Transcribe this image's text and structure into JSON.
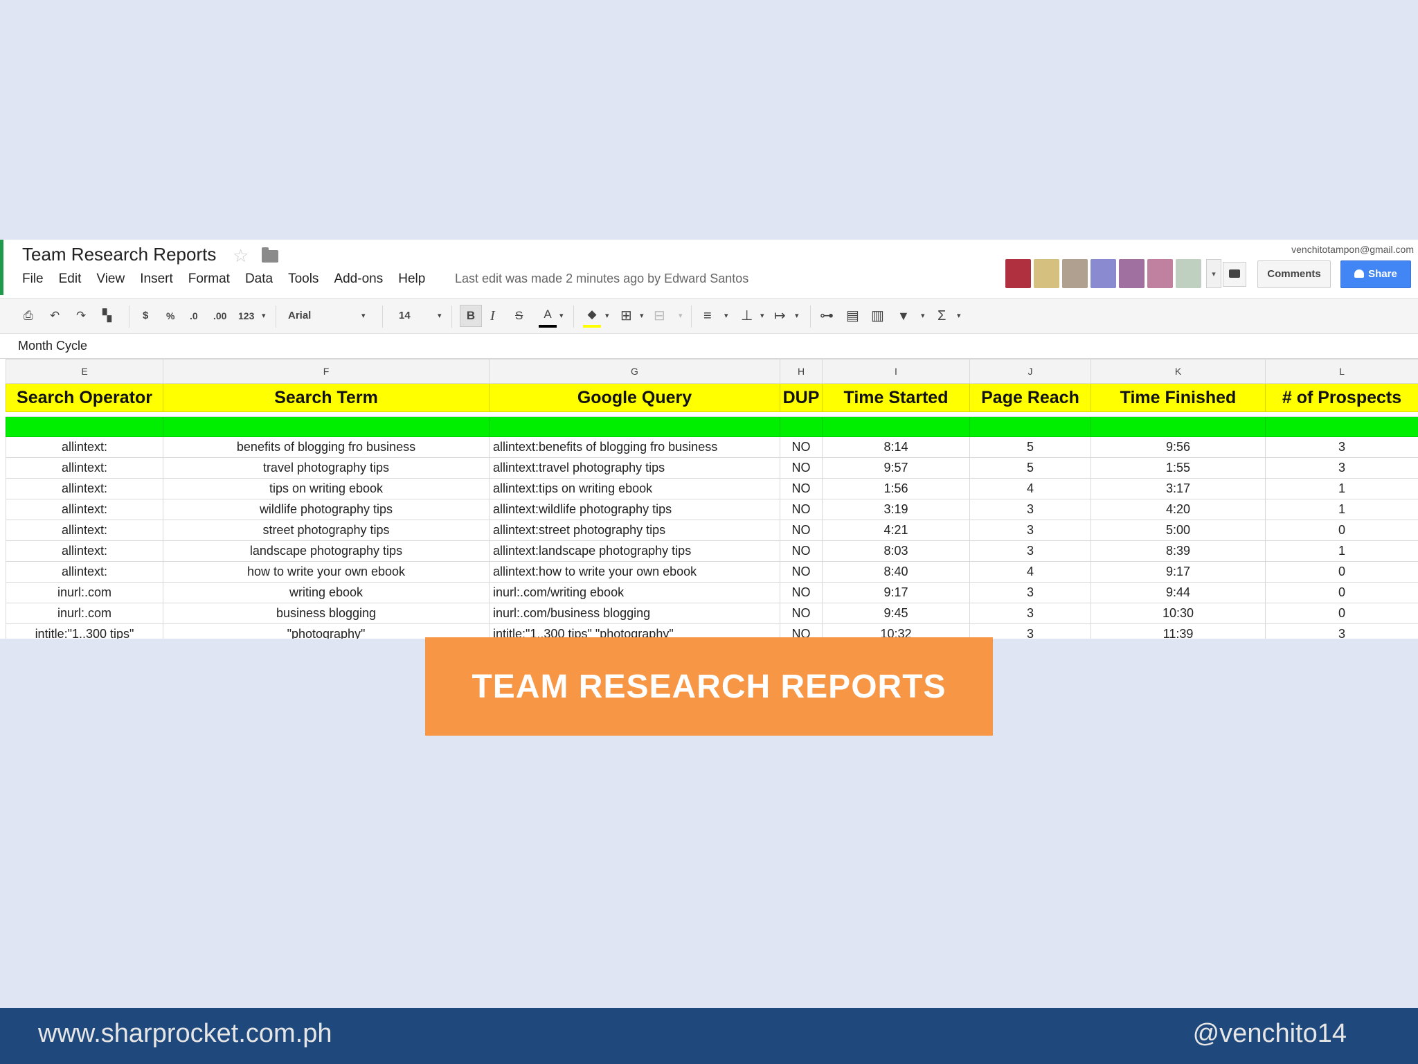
{
  "doc": {
    "title": "Team Research Reports",
    "account": "venchitotampon@gmail.com",
    "last_edit": "Last edit was made 2 minutes ago by Edward Santos",
    "menu": [
      "File",
      "Edit",
      "View",
      "Insert",
      "Format",
      "Data",
      "Tools",
      "Add-ons",
      "Help"
    ],
    "comments_label": "Comments",
    "share_label": "Share",
    "avatar_colors": [
      "#b03040",
      "#d6c080",
      "#b0a090",
      "#8a8ad0",
      "#a070a0",
      "#c080a0",
      "#c0d0c0",
      "#d0d0d0"
    ]
  },
  "toolbar": {
    "currency": "$",
    "percent": "%",
    "dec_less": ".0",
    "dec_more": ".00",
    "format_more": "123",
    "font": "Arial",
    "font_size": "14",
    "bold": "B",
    "italic": "I",
    "strike": "S",
    "text_color": "A",
    "sigma": "Σ"
  },
  "formula_bar": {
    "cell_value": "Month Cycle"
  },
  "sheet": {
    "columns": [
      "E",
      "F",
      "G",
      "H",
      "I",
      "J",
      "K",
      "L"
    ],
    "headers": [
      "Search Operator",
      "Search Term",
      "Google Query",
      "DUP",
      "Time Started",
      "Page Reach",
      "Time Finished",
      "# of Prospects"
    ],
    "rows": [
      [
        "allintext:",
        "benefits of blogging fro business",
        "allintext:benefits of blogging fro business",
        "NO",
        "8:14",
        "5",
        "9:56",
        "3"
      ],
      [
        "allintext:",
        "travel photography tips",
        "allintext:travel photography tips",
        "NO",
        "9:57",
        "5",
        "1:55",
        "3"
      ],
      [
        "allintext:",
        "tips on writing ebook",
        "allintext:tips on writing ebook",
        "NO",
        "1:56",
        "4",
        "3:17",
        "1"
      ],
      [
        "allintext:",
        "wildlife photography tips",
        "allintext:wildlife photography tips",
        "NO",
        "3:19",
        "3",
        "4:20",
        "1"
      ],
      [
        "allintext:",
        "street photography tips",
        "allintext:street photography tips",
        "NO",
        "4:21",
        "3",
        "5:00",
        "0"
      ],
      [
        "allintext:",
        "landscape photography tips",
        "allintext:landscape photography tips",
        "NO",
        "8:03",
        "3",
        "8:39",
        "1"
      ],
      [
        "allintext:",
        "how to write your own ebook",
        "allintext:how to write your own ebook",
        "NO",
        "8:40",
        "4",
        "9:17",
        "0"
      ],
      [
        "inurl:.com",
        "writing ebook",
        "inurl:.com/writing ebook",
        "NO",
        "9:17",
        "3",
        "9:44",
        "0"
      ],
      [
        "inurl:.com",
        "business blogging",
        "inurl:.com/business blogging",
        "NO",
        "9:45",
        "3",
        "10:30",
        "0"
      ],
      [
        "intitle:\"1..300 tips\"",
        "\"photography\"",
        "intitle:\"1..300 tips\" \"photography\"",
        "NO",
        "10:32",
        "3",
        "11:39",
        "3"
      ]
    ]
  },
  "banner": {
    "text": "TEAM RESEARCH REPORTS",
    "color": "#f79645"
  },
  "footer": {
    "website": "www.sharprocket.com.ph",
    "handle": "@venchito14",
    "color": "#1f497d"
  }
}
